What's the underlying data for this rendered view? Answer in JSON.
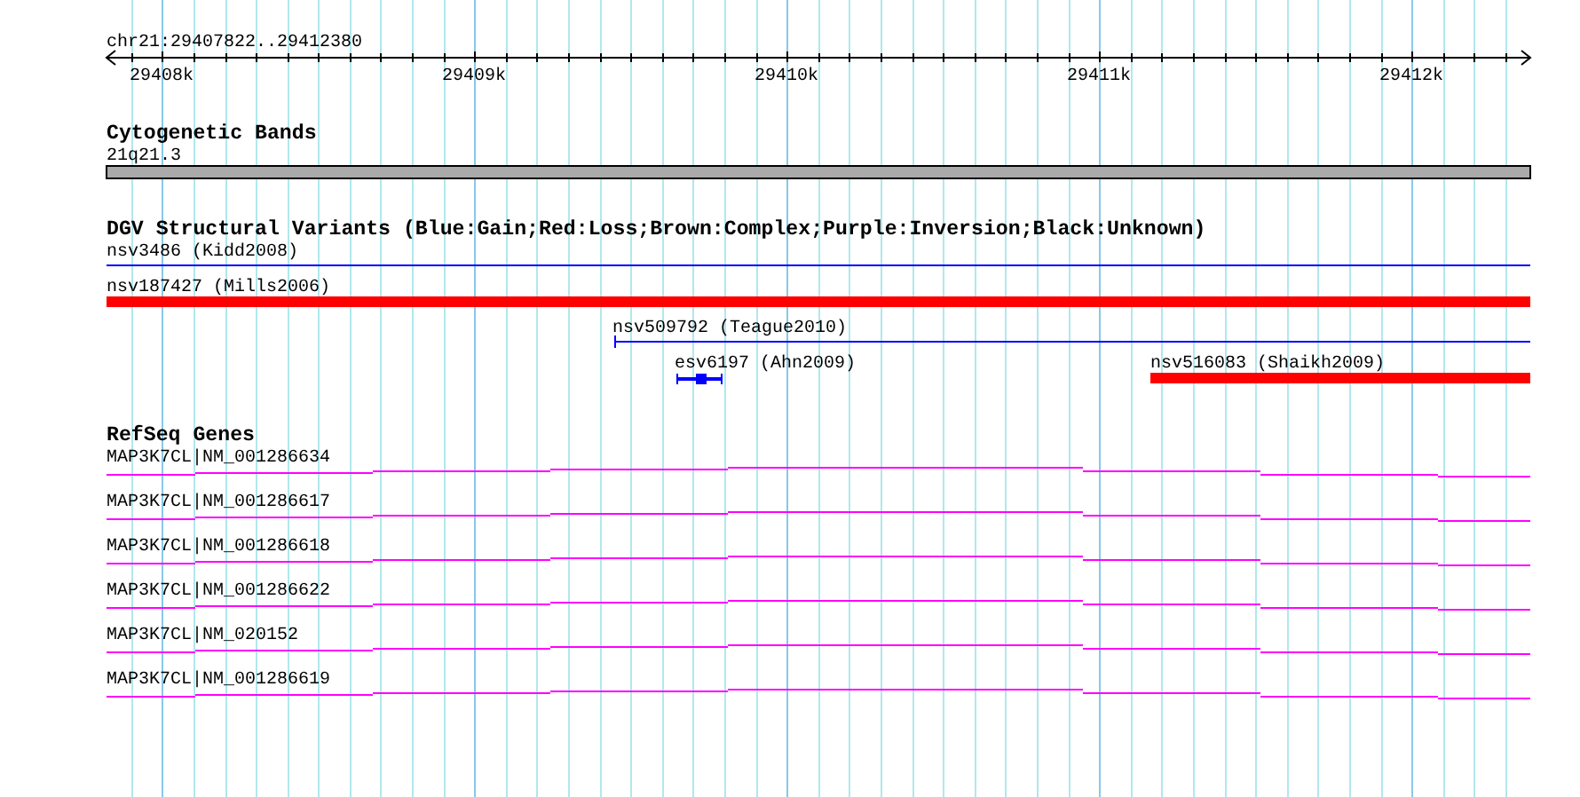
{
  "ruler": {
    "title": "chr21:29407822..29412380",
    "ticks": [
      "29408k",
      "29409k",
      "29410k",
      "29411k",
      "29412k"
    ]
  },
  "tracks": [
    {
      "kind": "cytoband",
      "title": "Cytogenetic Bands",
      "features": [
        {
          "label": "21q21.3"
        }
      ]
    },
    {
      "kind": "variants",
      "title": "DGV Structural Variants (Blue:Gain;Red:Loss;Brown:Complex;Purple:Inversion;Black:Unknown)",
      "features": [
        {
          "label": "nsv3486 (Kidd2008)",
          "kind": "line",
          "color": "#0000ff"
        },
        {
          "label": "nsv187427 (Mills2006)",
          "kind": "bar",
          "color": "#ff0000"
        },
        {
          "label": "nsv509792 (Teague2010)",
          "kind": "line",
          "color": "#0000ff"
        },
        {
          "label": "esv6197 (Ahn2009)",
          "kind": "segment",
          "color": "#0000ff"
        },
        {
          "label": "nsv516083 (Shaikh2009)",
          "kind": "bar",
          "color": "#ff0000"
        }
      ]
    },
    {
      "kind": "genes",
      "title": "RefSeq Genes",
      "features": [
        {
          "label": "MAP3K7CL|NM_001286634"
        },
        {
          "label": "MAP3K7CL|NM_001286617"
        },
        {
          "label": "MAP3K7CL|NM_001286618"
        },
        {
          "label": "MAP3K7CL|NM_001286622"
        },
        {
          "label": "MAP3K7CL|NM_020152"
        },
        {
          "label": "MAP3K7CL|NM_001286619"
        }
      ]
    }
  ]
}
